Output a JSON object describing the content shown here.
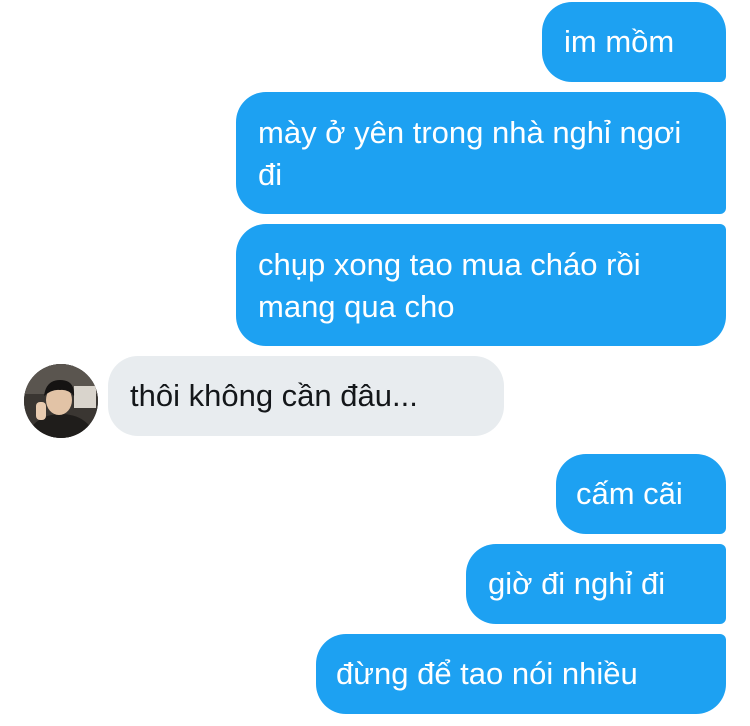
{
  "conversation": {
    "messages": [
      {
        "sender": "me",
        "text": "im mồm"
      },
      {
        "sender": "me",
        "text": "mày ở yên trong nhà nghỉ ngơi đi"
      },
      {
        "sender": "me",
        "text": "chụp xong tao mua cháo rồi mang qua cho"
      },
      {
        "sender": "other",
        "text": "thôi không cần đâu..."
      },
      {
        "sender": "me",
        "text": "cấm cãi"
      },
      {
        "sender": "me",
        "text": "giờ đi nghỉ đi"
      },
      {
        "sender": "me",
        "text": "đừng để tao nói nhiều"
      }
    ]
  },
  "colors": {
    "outgoing_bubble": "#1da1f2",
    "incoming_bubble": "#e8ecef",
    "outgoing_text": "#ffffff",
    "incoming_text": "#14171a"
  },
  "contact": {
    "avatar_icon": "user-avatar-photo"
  }
}
